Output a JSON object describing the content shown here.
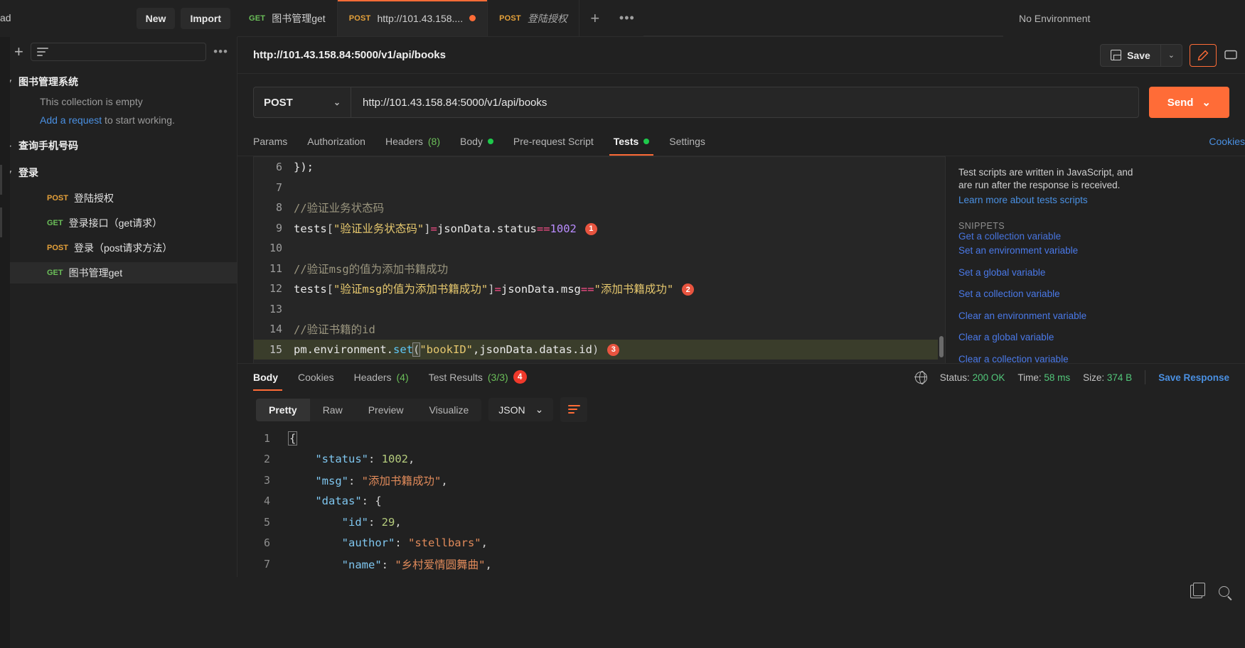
{
  "topbar": {
    "workspace_label": "ad",
    "new_button": "New",
    "import_button": "Import",
    "environment": "No Environment",
    "add_tab_icon": "+",
    "more_tabs_icon": "•••"
  },
  "request_tabs": [
    {
      "method": "GET",
      "name": "图书管理get",
      "active": false,
      "unsaved": false,
      "italic": false
    },
    {
      "method": "POST",
      "name": "http://101.43.158....",
      "active": true,
      "unsaved": true,
      "italic": false
    },
    {
      "method": "POST",
      "name": "登陆授权",
      "active": false,
      "unsaved": false,
      "italic": true
    }
  ],
  "sidebar": {
    "filter_placeholder": "",
    "add_icon": "+",
    "filter_icon": "filter-icon",
    "more_icon": "•••",
    "collections": [
      {
        "name": "图书管理系统",
        "expanded": true,
        "empty_text": "This collection is empty",
        "empty_link": "Add a request",
        "empty_suffix": " to start working."
      },
      {
        "name": "查询手机号码",
        "expanded": false
      },
      {
        "name": "登录",
        "expanded": true
      }
    ],
    "requests": [
      {
        "method": "POST",
        "name": "登陆授权",
        "selected": false
      },
      {
        "method": "GET",
        "name": "登录接口（get请求）",
        "selected": false
      },
      {
        "method": "POST",
        "name": "登录（post请求方法）",
        "selected": false
      },
      {
        "method": "GET",
        "name": "图书管理get",
        "selected": true
      }
    ]
  },
  "request": {
    "title": "http://101.43.158.84:5000/v1/api/books",
    "save_label": "Save",
    "save_caret": "⌄",
    "method": "POST",
    "url": "http://101.43.158.84:5000/v1/api/books",
    "send_label": "Send",
    "send_caret": "⌄",
    "cookies_link": "Cookies",
    "tabs": [
      {
        "label": "Params",
        "active": false
      },
      {
        "label": "Authorization",
        "active": false
      },
      {
        "label": "Headers",
        "count": "(8)",
        "active": false
      },
      {
        "label": "Body",
        "dot": true,
        "active": false
      },
      {
        "label": "Pre-request Script",
        "active": false
      },
      {
        "label": "Tests",
        "dot": true,
        "active": true
      },
      {
        "label": "Settings",
        "active": false
      }
    ]
  },
  "editor": {
    "lines": [
      {
        "n": "6",
        "tokens": [
          {
            "t": "});",
            "c": "plain"
          }
        ]
      },
      {
        "n": "7",
        "tokens": []
      },
      {
        "n": "8",
        "tokens": [
          {
            "t": "//验证业务状态码",
            "c": "comment"
          }
        ]
      },
      {
        "n": "9",
        "tokens": [
          {
            "t": "tests",
            "c": "plain"
          },
          {
            "t": "[",
            "c": "brk"
          },
          {
            "t": "\"验证业务状态码\"",
            "c": "str"
          },
          {
            "t": "]",
            "c": "brk"
          },
          {
            "t": "=",
            "c": "op"
          },
          {
            "t": "jsonData.status",
            "c": "plain"
          },
          {
            "t": "==",
            "c": "op"
          },
          {
            "t": "1002",
            "c": "num"
          }
        ],
        "badge": "1"
      },
      {
        "n": "10",
        "tokens": []
      },
      {
        "n": "11",
        "tokens": [
          {
            "t": "//验证msg的值为添加书籍成功",
            "c": "comment"
          }
        ]
      },
      {
        "n": "12",
        "tokens": [
          {
            "t": "tests",
            "c": "plain"
          },
          {
            "t": "[",
            "c": "brk"
          },
          {
            "t": "\"验证msg的值为添加书籍成功\"",
            "c": "str"
          },
          {
            "t": "]",
            "c": "brk"
          },
          {
            "t": "=",
            "c": "op"
          },
          {
            "t": "jsonData.msg",
            "c": "plain"
          },
          {
            "t": "==",
            "c": "op"
          },
          {
            "t": "\"添加书籍成功\"",
            "c": "str"
          }
        ],
        "badge": "2"
      },
      {
        "n": "13",
        "tokens": []
      },
      {
        "n": "14",
        "tokens": [
          {
            "t": "//验证书籍的id",
            "c": "comment"
          }
        ]
      },
      {
        "n": "15",
        "tokens": [
          {
            "t": "pm.environment.",
            "c": "plain"
          },
          {
            "t": "set",
            "c": "fn"
          },
          {
            "t": "(",
            "c": "brk",
            "cursor": true
          },
          {
            "t": "\"bookID\"",
            "c": "str"
          },
          {
            "t": ",",
            "c": "plain"
          },
          {
            "t": "jsonData.datas.id",
            "c": "plain"
          },
          {
            "t": ")",
            "c": "brk"
          }
        ],
        "badge": "3",
        "highlight": true
      }
    ]
  },
  "snippets": {
    "help_line1": "Test scripts are written in JavaScript, and",
    "help_line2": "are run after the response is received.",
    "learn_link": "Learn more about tests scripts",
    "heading": "SNIPPETS",
    "clipped_item": "Get a collection variable",
    "items": [
      "Set an environment variable",
      "Set a global variable",
      "Set a collection variable",
      "Clear an environment variable",
      "Clear a global variable",
      "Clear a collection variable"
    ]
  },
  "response": {
    "tabs": [
      {
        "label": "Body",
        "active": true
      },
      {
        "label": "Cookies",
        "active": false
      },
      {
        "label": "Headers",
        "count": "(4)",
        "active": false
      },
      {
        "label": "Test Results",
        "count": "(3/3)",
        "badge": "4",
        "active": false
      }
    ],
    "status_label": "Status:",
    "status_value": "200 OK",
    "time_label": "Time:",
    "time_value": "58 ms",
    "size_label": "Size:",
    "size_value": "374 B",
    "save_response": "Save Response",
    "view_modes": [
      {
        "label": "Pretty",
        "active": true
      },
      {
        "label": "Raw",
        "active": false
      },
      {
        "label": "Preview",
        "active": false
      },
      {
        "label": "Visualize",
        "active": false
      }
    ],
    "format": "JSON",
    "format_caret": "⌄",
    "wrap_icon": "wrap-lines-icon",
    "copy_icon": "copy-icon",
    "search_icon": "search-icon",
    "body_lines": [
      {
        "n": "1",
        "indent": 0,
        "tokens": [
          {
            "t": "{",
            "c": "punc",
            "box": true
          }
        ]
      },
      {
        "n": "2",
        "indent": 1,
        "tokens": [
          {
            "t": "\"status\"",
            "c": "key"
          },
          {
            "t": ": ",
            "c": "punc"
          },
          {
            "t": "1002",
            "c": "num"
          },
          {
            "t": ",",
            "c": "punc"
          }
        ]
      },
      {
        "n": "3",
        "indent": 1,
        "tokens": [
          {
            "t": "\"msg\"",
            "c": "key"
          },
          {
            "t": ": ",
            "c": "punc"
          },
          {
            "t": "\"添加书籍成功\"",
            "c": "str"
          },
          {
            "t": ",",
            "c": "punc"
          }
        ]
      },
      {
        "n": "4",
        "indent": 1,
        "tokens": [
          {
            "t": "\"datas\"",
            "c": "key"
          },
          {
            "t": ": ",
            "c": "punc"
          },
          {
            "t": "{",
            "c": "punc"
          }
        ]
      },
      {
        "n": "5",
        "indent": 2,
        "tokens": [
          {
            "t": "\"id\"",
            "c": "key"
          },
          {
            "t": ": ",
            "c": "punc"
          },
          {
            "t": "29",
            "c": "num"
          },
          {
            "t": ",",
            "c": "punc"
          }
        ]
      },
      {
        "n": "6",
        "indent": 2,
        "tokens": [
          {
            "t": "\"author\"",
            "c": "key"
          },
          {
            "t": ": ",
            "c": "punc"
          },
          {
            "t": "\"stellbars\"",
            "c": "str"
          },
          {
            "t": ",",
            "c": "punc"
          }
        ]
      },
      {
        "n": "7",
        "indent": 2,
        "tokens": [
          {
            "t": "\"name\"",
            "c": "key"
          },
          {
            "t": ": ",
            "c": "punc"
          },
          {
            "t": "\"乡村爱情圆舞曲\"",
            "c": "str"
          },
          {
            "t": ",",
            "c": "punc"
          }
        ]
      }
    ]
  },
  "colors": {
    "accent": "#ff6c37",
    "link": "#4a90e2",
    "get_method": "#6bbf59",
    "post_method": "#e5a13a",
    "status_ok": "#52c77a",
    "badge_red": "#f0392b"
  }
}
